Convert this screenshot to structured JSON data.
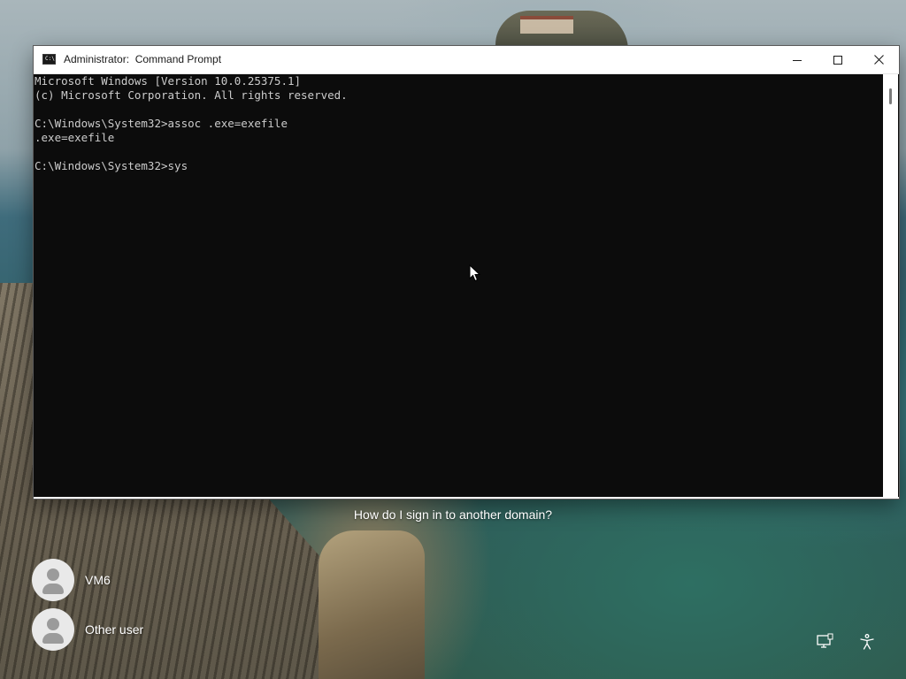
{
  "window": {
    "title": "Administrator:  Command Prompt",
    "icon_text": "C:\\",
    "icon": "command-prompt-icon"
  },
  "console": {
    "lines": [
      "Microsoft Windows [Version 10.0.25375.1]",
      "(c) Microsoft Corporation. All rights reserved.",
      "",
      "C:\\Windows\\System32>assoc .exe=exefile",
      ".exe=exefile",
      "",
      "C:\\Windows\\System32>sys"
    ],
    "background": "#0c0c0c",
    "foreground": "#cccccc"
  },
  "signin": {
    "help_link": "How do I sign in to another domain?",
    "users": [
      {
        "name": "VM6"
      },
      {
        "name": "Other user"
      }
    ]
  },
  "tray": {
    "network_icon": "network-icon",
    "accessibility_icon": "accessibility-icon"
  }
}
